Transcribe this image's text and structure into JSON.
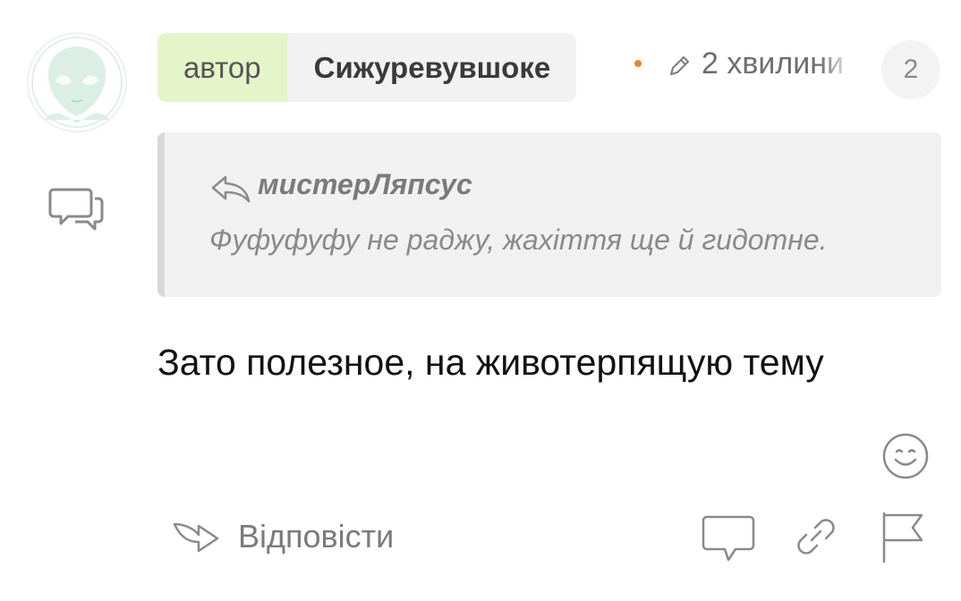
{
  "comment": {
    "author_role": "автор",
    "author_name": "Сижуревувшоке",
    "time_label": "2 хвилини",
    "reply_count": "2",
    "quote": {
      "author": "мистерЛяпсус",
      "text": "Фуфуфуфу не раджу, жахіття ще й гидотне."
    },
    "body": "Зато полезное, на животерпящую тему",
    "reply_label": "Відповісти"
  },
  "icons": {
    "avatar": "alien-face-avatar",
    "side": "comment-bubbles-icon",
    "edited": "pencil-icon",
    "quote_reply": "reply-arrow-icon",
    "emoji": "smiley-icon",
    "reply": "reply-icon",
    "actions": [
      "comment-icon",
      "link-icon",
      "flag-icon"
    ]
  },
  "colors": {
    "role_background": "#e6f4c9",
    "pill_background": "#f2f2f2",
    "dot": "#f0813a",
    "quote_background": "#f1f1f1",
    "quote_bar": "#d8d8d8",
    "icon_gray": "#8a8a8a"
  }
}
